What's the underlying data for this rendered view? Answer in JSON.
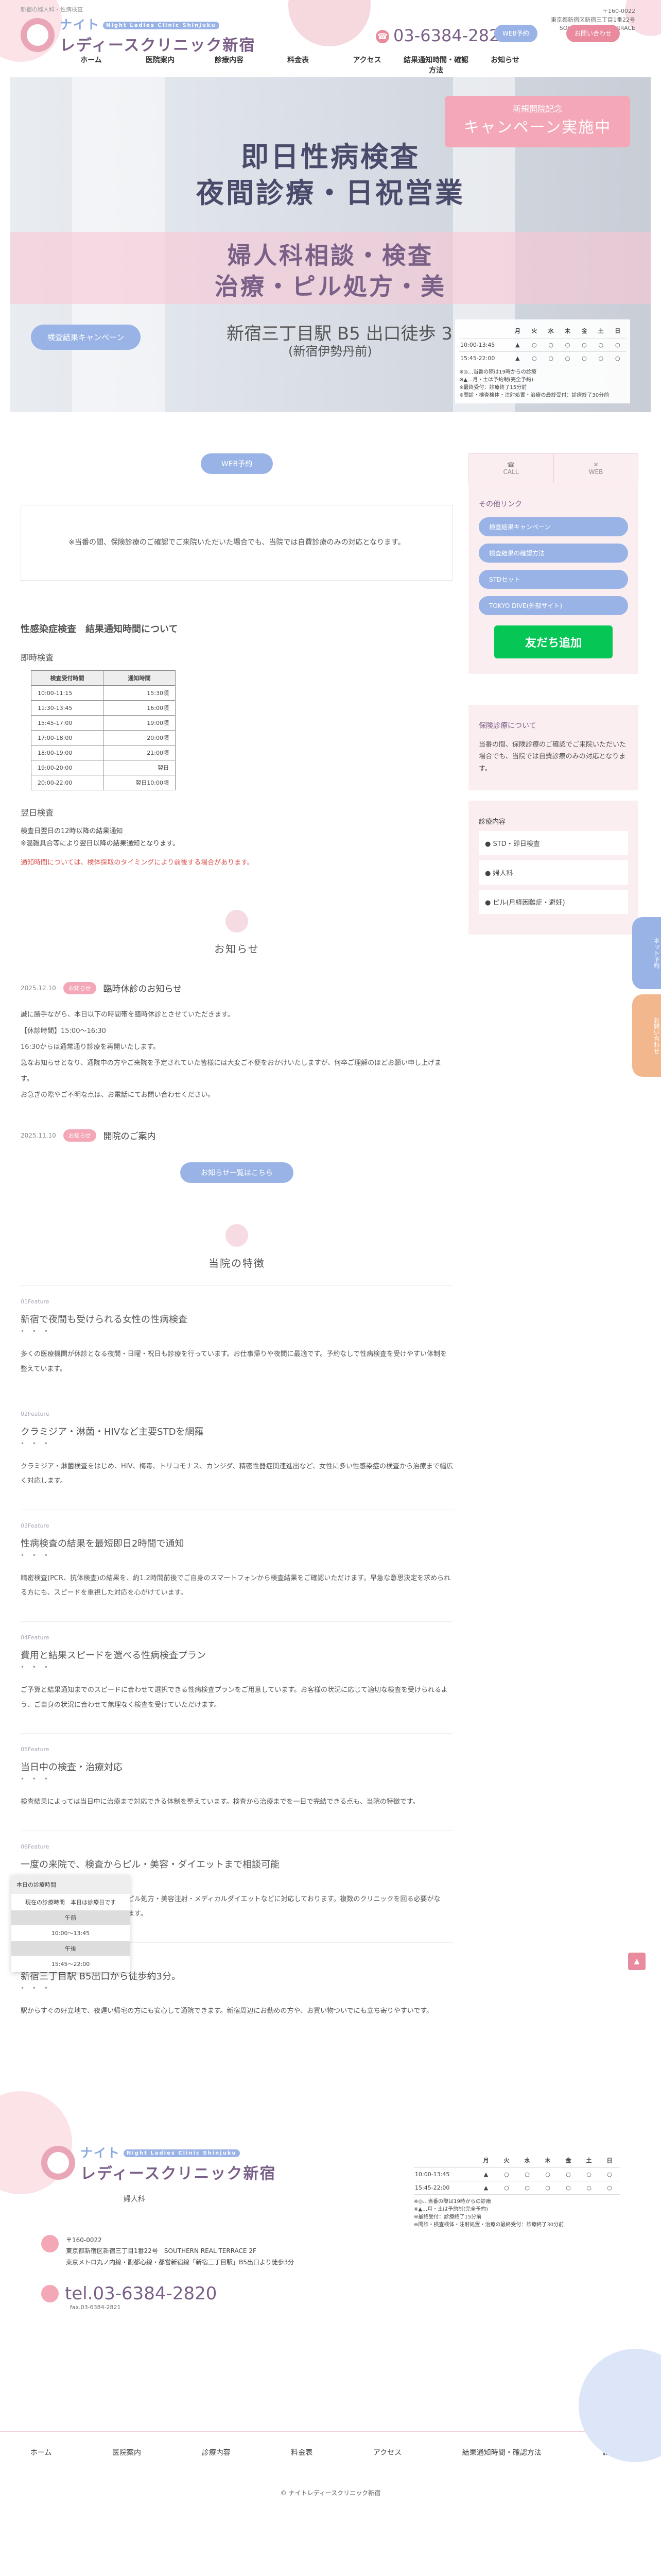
{
  "header": {
    "tagline": "新宿の婦人科・性病検査",
    "logo_line1": "ナイト",
    "logo_line2": "レディースクリニック新宿",
    "logo_en": "Night Ladies Clinic Shinjuku",
    "tel": "03-6384-2820",
    "address_line1": "〒160-0022",
    "address_line2": "東京都新宿区新宿三丁目1番22号",
    "address_line3": "SOUTHERN REAL TERRACE",
    "web_btn": "WEB予約",
    "line_btn": "お問い合わせ",
    "nav": [
      "ホーム",
      "医院案内",
      "診療内容",
      "料金表",
      "アクセス",
      "結果通知時間・確認方法",
      "お知らせ"
    ]
  },
  "hero": {
    "line1": "即日性病検査",
    "line2": "夜間診療・日祝営業",
    "line3": "婦人科相談・検査",
    "line4": "治療・ピル処方・美",
    "station": "新宿三丁目駅 B5 出口徒歩 3",
    "station2": "(新宿伊勢丹前)",
    "campaign_small": "新規開院記念",
    "campaign_large": "キャンペーン実施中",
    "campaign_btn": "検査結果キャンペーン"
  },
  "schedule": {
    "days": [
      "",
      "月",
      "火",
      "水",
      "木",
      "金",
      "土",
      "日"
    ],
    "rows": [
      {
        "time": "10:00-13:45",
        "marks": [
          "▲",
          "○",
          "○",
          "○",
          "○",
          "○",
          "○"
        ]
      },
      {
        "time": "15:45-22:00",
        "marks": [
          "▲",
          "○",
          "○",
          "○",
          "○",
          "○",
          "○"
        ]
      }
    ],
    "notes": [
      "※◎…当番の際は19時からの診療",
      "※▲…月・土は予約制(完全予約)",
      "※最終受付：診療終了15分前",
      "※問診・検査検体・注射処置・治療の最終受付：診療終了30分前"
    ]
  },
  "main": {
    "web_btn": "WEB予約",
    "notice": "※当番の間、保険診療のご確認でご来院いただいた場合でも、当院では自費診療のみの対応となります。",
    "std_title": "性感染症検査　結果通知時間について",
    "std_sub": "即時検査",
    "std_table_head": [
      "検査受付時間",
      "通知時間"
    ],
    "std_table_rows": [
      [
        "10:00-11:15",
        "15:30頃"
      ],
      [
        "11:30-13:45",
        "16:00頃"
      ],
      [
        "15:45-17:00",
        "19:00頃"
      ],
      [
        "17:00-18:00",
        "20:00頃"
      ],
      [
        "18:00-19:00",
        "21:00頃"
      ],
      [
        "19:00-20:00",
        "翌日"
      ],
      [
        "20:00-22:00",
        "翌日10:00頃"
      ]
    ],
    "next_title": "翌日検査",
    "next_line1": "検査日翌日の12時以降の結果通知",
    "next_line2": "※混雑具合等により翌日以降の結果通知となります。",
    "red_note": "通知時間については、検体採取のタイミングにより前後する場合があります。"
  },
  "news": {
    "title": "お知らせ",
    "items": [
      {
        "date": "2025.12.10",
        "tag": "お知らせ",
        "title": "臨時休診のお知らせ",
        "body": [
          "誠に勝手ながら、本日以下の時間帯を臨時休診とさせていただきます。",
          "【休診時間】15:00～16:30",
          "16:30からは通常通り診療を再開いたします。",
          "急なお知らせとなり、通院中の方やご来院を予定されていた皆様には大変ご不便をおかけいたしますが、何卒ご理解のほどお願い申し上げます。",
          "お急ぎの際やご不明な点は、お電話にてお問い合わせください。"
        ]
      },
      {
        "date": "2025.11.10",
        "tag": "お知らせ",
        "title": "開院のご案内",
        "body": []
      }
    ],
    "more_btn": "お知らせ一覧はこちら"
  },
  "features": {
    "title": "当院の特徴",
    "items": [
      {
        "pt": "01Feature",
        "title": "新宿で夜間も受けられる女性の性病検査",
        "body": "多くの医療機関が休診となる夜間・日曜・祝日も診療を行っています。お仕事帰りや夜間に最適です。予約なしで性病検査を受けやすい体制を整えています。"
      },
      {
        "pt": "02Feature",
        "title": "クラミジア・淋菌・HIVなど主要STDを網羅",
        "body": "クラミジア・淋菌検査をはじめ、HIV、梅毒、トリコモナス、カンジダ、精密性器症関連進出など、女性に多い性感染症の検査から治療まで幅広く対応します。"
      },
      {
        "pt": "03Feature",
        "title": "性病検査の結果を最短即日2時間で通知",
        "body": "精密検査(PCR、抗体検査)の結果を、約1.2時間前後でご自身のスマートフォンから検査結果をご確認いただけます。早急な意思決定を求められる方にも、スピードを重視した対応を心がけています。"
      },
      {
        "pt": "04Feature",
        "title": "費用と結果スピードを選べる性病検査プラン",
        "body": "ご予算と結果通知までのスピードに合わせて選択できる性病検査プランをご用意しています。お客様の状況に応じて適切な検査を受けられるよう、ご自身の状況に合わせて無理なく検査を受けていただけます。"
      },
      {
        "pt": "05Feature",
        "title": "当日中の検査・治療対応",
        "body": "検査結果によっては当日中に治療まで対応できる体制を整えています。検査から治療までを一日で完結できる点も、当院の特徴です。"
      },
      {
        "pt": "06Feature",
        "title": "一度の来院で、検査からピル・美容・ダイエットまで相談可能",
        "body": "当院では、性病検査を中心に、各種ピル処方・美容注射・メディカルダイエットなどに対応しております。複数のクリニックを回る必要がなく、同日にまとめてご相談いただけます。"
      },
      {
        "pt": "07Feature",
        "title": "新宿三丁目駅 B5出口から徒歩約3分。",
        "body": "駅からすぐの好立地で、夜遅い帰宅の方にも安心して通院できます。新宿周辺にお勤めの方や、お買い物ついでにも立ち寄りやすいです。"
      }
    ]
  },
  "popup": {
    "head": "本日の診療時間",
    "sub": "現在の診療時間　本日は診療日です",
    "label": "午前",
    "row1": "10:00～13:45",
    "label2": "午後",
    "row2": "15:45～22:00"
  },
  "side": {
    "tab1": "CALL",
    "tab2": "WEB",
    "links_label": "その他リンク",
    "links": [
      "検査結果キャンペーン",
      "検査結果の確認方法",
      "STDセット",
      "TOKYO DIVE(外部サイト)"
    ],
    "line_btn": "友だち追加",
    "insurance_label": "保険診療について",
    "insurance_text": "当番の間、保険診療のご確認でご来院いただいた場合でも、当院では自費診療のみの対応となります。",
    "menu_label": "診療内容",
    "menu": [
      "STD・即日検査",
      "婦人科",
      "ピル(月経困難症・避妊)"
    ]
  },
  "float": {
    "tab_a": "ネット予約",
    "tab_b": "お問い合わせ",
    "pagetop": "▲"
  },
  "footer": {
    "sub": "婦人科",
    "address_line1": "〒160-0022",
    "address_line2": "東京都新宿区新宿三丁目1番22号　SOUTHERN REAL TERRACE 2F",
    "address_line3": "東京メトロ丸ノ内線・副都心線・都営新宿線「新宿三丁目駅」B5出口より徒歩3分",
    "tel": "tel.03-6384-2820",
    "fax": "fax.03-6384-2821",
    "nav": [
      "ホーム",
      "医院案内",
      "診療内容",
      "料金表",
      "アクセス",
      "結果通知時間・確認方法",
      "お知らせ"
    ],
    "copyright": "© ナイトレディースクリニック新宿"
  },
  "colors": {
    "accent_blue": "#9ab3e6",
    "accent_pink": "#e98a9e",
    "brand_purple": "#7a5f87",
    "line_green": "#06c755"
  }
}
